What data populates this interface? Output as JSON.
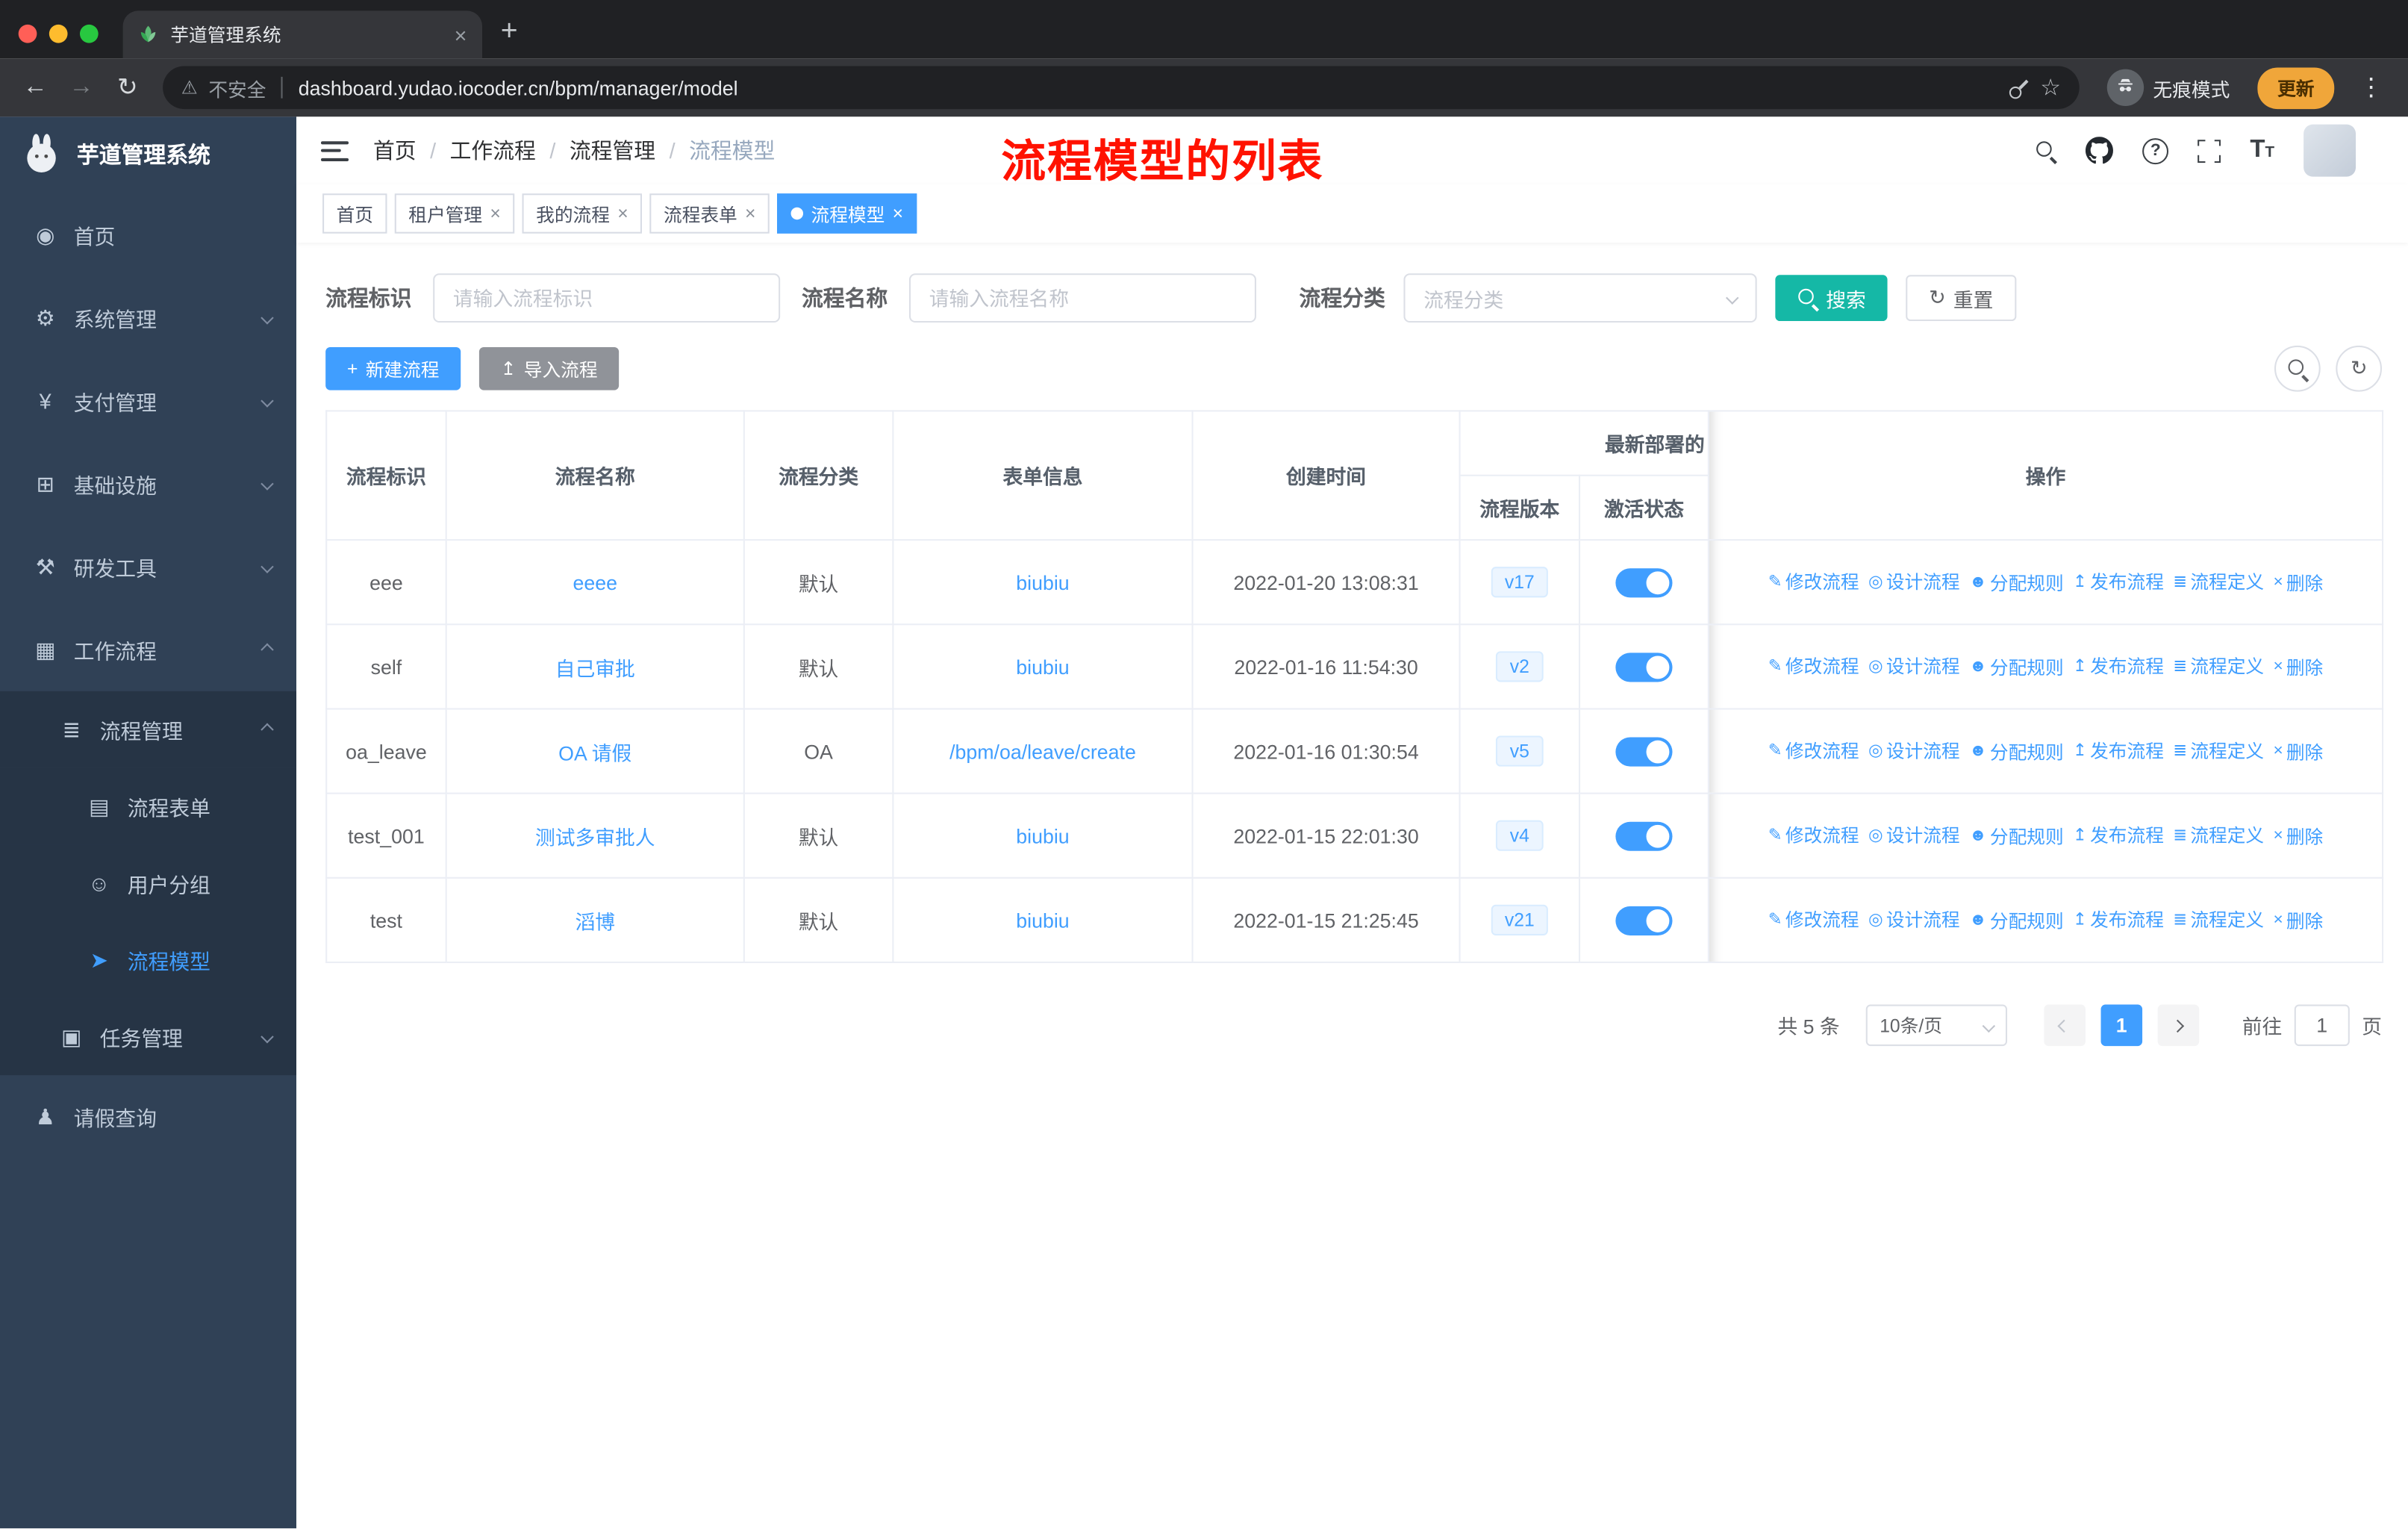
{
  "colors": {
    "primary": "#409eff",
    "search_button": "#15b8a6",
    "sidebar_bg": "#304156",
    "annotation": "#ff1200"
  },
  "browser": {
    "tab_title": "芋道管理系统",
    "security_label": "不安全",
    "url": "dashboard.yudao.iocoder.cn/bpm/manager/model",
    "incognito_label": "无痕模式",
    "update_label": "更新"
  },
  "sidebar": {
    "title": "芋道管理系统",
    "items": [
      {
        "name": "home",
        "label": "首页",
        "icon": "dashboard-icon",
        "level": 0
      },
      {
        "name": "system-management",
        "label": "系统管理",
        "icon": "gear-icon",
        "level": 0,
        "chevron": "down"
      },
      {
        "name": "payment-management",
        "label": "支付管理",
        "icon": "yen-icon",
        "level": 0,
        "chevron": "down"
      },
      {
        "name": "infrastructure",
        "label": "基础设施",
        "icon": "infrastructure-icon",
        "level": 0,
        "chevron": "down"
      },
      {
        "name": "dev-tools",
        "label": "研发工具",
        "icon": "dev-tools-icon",
        "level": 0,
        "chevron": "down"
      },
      {
        "name": "workflow",
        "label": "工作流程",
        "icon": "workflow-icon",
        "level": 0,
        "chevron": "up"
      },
      {
        "name": "process-management",
        "label": "流程管理",
        "icon": "process-manage-icon",
        "level": 1,
        "chevron": "up",
        "sub": true
      },
      {
        "name": "process-form",
        "label": "流程表单",
        "icon": "process-form-icon",
        "level": 2,
        "sub": true
      },
      {
        "name": "user-group",
        "label": "用户分组",
        "icon": "user-group-icon",
        "level": 2,
        "sub": true
      },
      {
        "name": "process-model",
        "label": "流程模型",
        "icon": "process-model-icon",
        "level": 2,
        "sub": true,
        "active": true
      },
      {
        "name": "task-management",
        "label": "任务管理",
        "icon": "task-manage-icon",
        "level": 1,
        "chevron": "down",
        "sub": true
      },
      {
        "name": "leave-query",
        "label": "请假查询",
        "icon": "leave-query-icon",
        "level": 0
      }
    ]
  },
  "header": {
    "breadcrumb": [
      "首页",
      "工作流程",
      "流程管理",
      "流程模型"
    ],
    "annotation": "流程模型的列表"
  },
  "tags": [
    {
      "name": "tag-home",
      "label": "首页",
      "closable": false,
      "active": false
    },
    {
      "name": "tag-tenant-management",
      "label": "租户管理",
      "closable": true,
      "active": false
    },
    {
      "name": "tag-my-process",
      "label": "我的流程",
      "closable": true,
      "active": false
    },
    {
      "name": "tag-process-form",
      "label": "流程表单",
      "closable": true,
      "active": false
    },
    {
      "name": "tag-process-model",
      "label": "流程模型",
      "closable": true,
      "active": true
    }
  ],
  "filters": {
    "id_label": "流程标识",
    "id_placeholder": "请输入流程标识",
    "name_label": "流程名称",
    "name_placeholder": "请输入流程名称",
    "category_label": "流程分类",
    "category_placeholder": "流程分类",
    "search_label": "搜索",
    "reset_label": "重置"
  },
  "toolbar": {
    "create_label": "新建流程",
    "import_label": "导入流程"
  },
  "table": {
    "headers": {
      "id": "流程标识",
      "name": "流程名称",
      "category": "流程分类",
      "form": "表单信息",
      "created": "创建时间",
      "deploy_group": "最新部署的",
      "version": "流程版本",
      "active": "激活状态",
      "actions": "操作"
    },
    "action_items": [
      {
        "name": "modify-process-link",
        "icon": "edit-icon",
        "label": "修改流程"
      },
      {
        "name": "design-process-link",
        "icon": "design-icon",
        "label": "设计流程"
      },
      {
        "name": "assign-rule-link",
        "icon": "assign-icon",
        "label": "分配规则"
      },
      {
        "name": "publish-process-link",
        "icon": "publish-icon",
        "label": "发布流程"
      },
      {
        "name": "process-definition-link",
        "icon": "definition-icon",
        "label": "流程定义"
      },
      {
        "name": "delete-link",
        "icon": "delete-icon",
        "label": "删除"
      }
    ],
    "rows": [
      {
        "id": "eee",
        "name": "eeee",
        "category": "默认",
        "form": "biubiu",
        "created": "2022-01-20 13:08:31",
        "version": "v17",
        "active": true
      },
      {
        "id": "self",
        "name": "自己审批",
        "category": "默认",
        "form": "biubiu",
        "created": "2022-01-16 11:54:30",
        "version": "v2",
        "active": true
      },
      {
        "id": "oa_leave",
        "name": "OA 请假",
        "category": "OA",
        "form": "/bpm/oa/leave/create",
        "created": "2022-01-16 01:30:54",
        "version": "v5",
        "active": true
      },
      {
        "id": "test_001",
        "name": "测试多审批人",
        "category": "默认",
        "form": "biubiu",
        "created": "2022-01-15 22:01:30",
        "version": "v4",
        "active": true
      },
      {
        "id": "test",
        "name": "滔博",
        "category": "默认",
        "form": "biubiu",
        "created": "2022-01-15 21:25:45",
        "version": "v21",
        "active": true
      }
    ]
  },
  "pagination": {
    "total": "共 5 条",
    "page_size": "10条/页",
    "current_page": "1",
    "goto_label": "前往",
    "goto_value": "1",
    "page_unit": "页"
  }
}
